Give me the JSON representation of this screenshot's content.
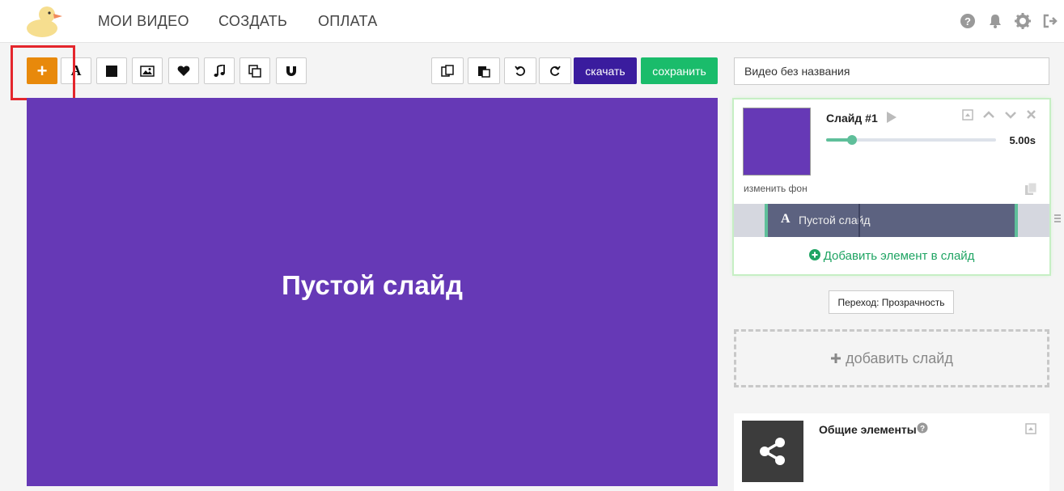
{
  "nav": {
    "links": [
      "МОИ ВИДЕО",
      "СОЗДАТЬ",
      "ОПЛАТА"
    ],
    "icons": [
      "help-icon",
      "bell-icon",
      "gear-icon",
      "logout-icon"
    ]
  },
  "toolbar": {
    "add_label": "+",
    "download_label": "скачать",
    "save_label": "сохранить",
    "download_color": "#3a1c9e",
    "save_color": "#1abc6b"
  },
  "canvas": {
    "text": "Пустой слайд",
    "background": "#6639b6"
  },
  "video": {
    "title": "Видео без названия"
  },
  "slide": {
    "title": "Слайд #1",
    "duration": "5.00s",
    "duration_fraction": 0.15,
    "change_bg_label": "изменить фон",
    "element_label": "Пустой слайд",
    "add_element_label": "Добавить элемент в слайд"
  },
  "transition": {
    "label": "Переход: Прозрачность"
  },
  "add_slide": {
    "label": "добавить слайд"
  },
  "common": {
    "title": "Общие элементы"
  }
}
